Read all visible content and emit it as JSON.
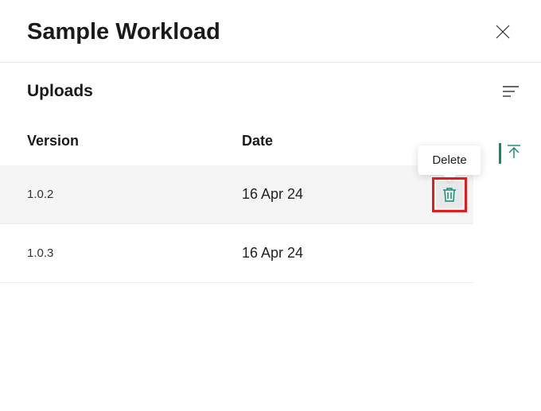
{
  "header": {
    "title": "Sample Workload"
  },
  "section": {
    "title": "Uploads"
  },
  "table": {
    "columns": {
      "version": "Version",
      "date": "Date"
    },
    "rows": [
      {
        "version": "1.0.2",
        "date": "16 Apr 24",
        "selected": true
      },
      {
        "version": "1.0.3",
        "date": "16 Apr 24",
        "selected": false
      }
    ]
  },
  "tooltip": {
    "delete": "Delete"
  },
  "colors": {
    "accent": "#0f8b6c",
    "highlight": "#e31b1b"
  }
}
